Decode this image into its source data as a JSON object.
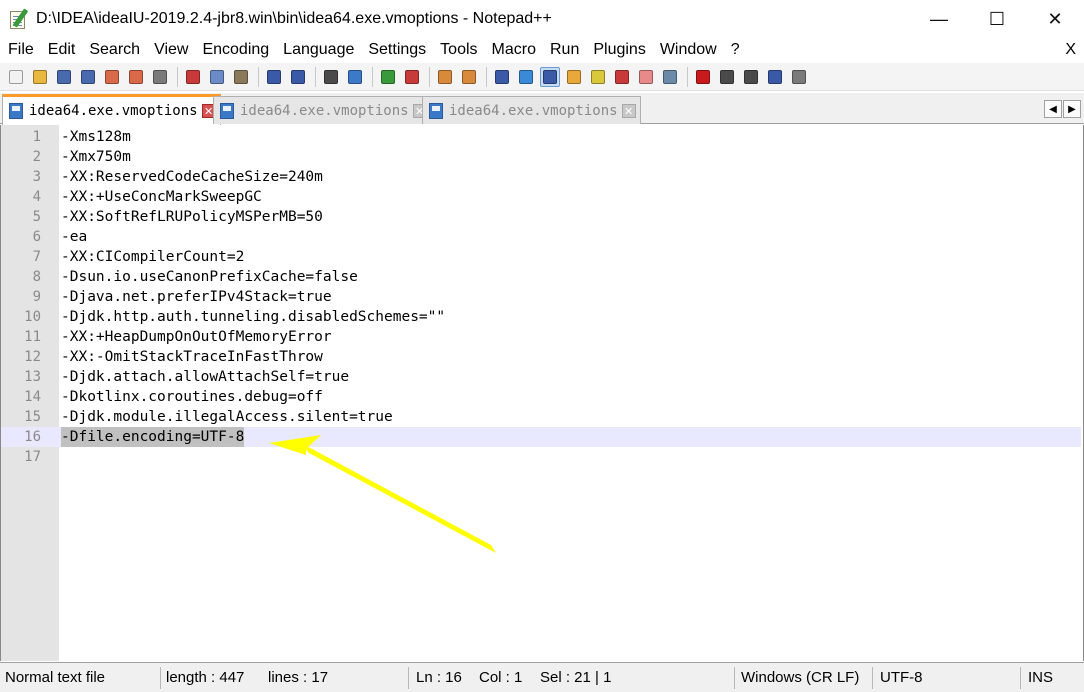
{
  "window": {
    "title": "D:\\IDEA\\ideaIU-2019.2.4-jbr8.win\\bin\\idea64.exe.vmoptions - Notepad++",
    "minimize": "—",
    "maximize": "☐",
    "close": "✕"
  },
  "menu": {
    "items": [
      "File",
      "Edit",
      "Search",
      "View",
      "Encoding",
      "Language",
      "Settings",
      "Tools",
      "Macro",
      "Run",
      "Plugins",
      "Window",
      "?"
    ],
    "close_doc": "X"
  },
  "toolbar": {
    "icons": [
      {
        "name": "new-file-icon",
        "color": "#f2f2f2"
      },
      {
        "name": "open-file-icon",
        "color": "#e8b840"
      },
      {
        "name": "save-icon",
        "color": "#4a6ab0"
      },
      {
        "name": "save-all-icon",
        "color": "#4a6ab0"
      },
      {
        "name": "close-icon",
        "color": "#d86a4a"
      },
      {
        "name": "close-all-icon",
        "color": "#d86a4a"
      },
      {
        "name": "print-icon",
        "color": "#7a7a7a"
      },
      {
        "name": "sep"
      },
      {
        "name": "cut-icon",
        "color": "#c83a3a"
      },
      {
        "name": "copy-icon",
        "color": "#6a8ac8"
      },
      {
        "name": "paste-icon",
        "color": "#8a7a5a"
      },
      {
        "name": "sep"
      },
      {
        "name": "undo-icon",
        "color": "#3a5aa8"
      },
      {
        "name": "redo-icon",
        "color": "#3a5aa8"
      },
      {
        "name": "sep"
      },
      {
        "name": "find-icon",
        "color": "#4a4a4a"
      },
      {
        "name": "replace-icon",
        "color": "#3a7ac8"
      },
      {
        "name": "sep"
      },
      {
        "name": "zoom-in-icon",
        "color": "#3a9a3a"
      },
      {
        "name": "zoom-out-icon",
        "color": "#c83a3a"
      },
      {
        "name": "sep"
      },
      {
        "name": "sync-vertical-icon",
        "color": "#d88a3a"
      },
      {
        "name": "sync-horizontal-icon",
        "color": "#d88a3a"
      },
      {
        "name": "sep"
      },
      {
        "name": "word-wrap-icon",
        "color": "#3a5aa8"
      },
      {
        "name": "show-all-chars-icon",
        "color": "#3a8ad8"
      },
      {
        "name": "indent-guide-icon",
        "color": "#3a5aa8",
        "active": true
      },
      {
        "name": "user-define-language-icon",
        "color": "#e8a83a"
      },
      {
        "name": "document-map-icon",
        "color": "#d8c83a"
      },
      {
        "name": "function-list-icon",
        "color": "#c83a3a"
      },
      {
        "name": "folder-as-workspace-icon",
        "color": "#e88a8a"
      },
      {
        "name": "monitoring-icon",
        "color": "#6a8aa8"
      },
      {
        "name": "sep"
      },
      {
        "name": "record-macro-icon",
        "color": "#c81a1a"
      },
      {
        "name": "stop-recording-icon",
        "color": "#4a4a4a"
      },
      {
        "name": "play-macro-icon",
        "color": "#4a4a4a"
      },
      {
        "name": "run-macro-multiple-icon",
        "color": "#3a5aa8"
      },
      {
        "name": "save-macro-icon",
        "color": "#7a7a7a"
      }
    ]
  },
  "tabs": [
    {
      "label": "idea64.exe.vmoptions",
      "active": true
    },
    {
      "label": "idea64.exe.vmoptions",
      "active": false
    },
    {
      "label": "idea64.exe.vmoptions",
      "active": false
    }
  ],
  "tab_scroll": {
    "left": "◀",
    "right": "▶"
  },
  "editor": {
    "lines": [
      {
        "num": "1",
        "text": "-Xms128m"
      },
      {
        "num": "2",
        "text": "-Xmx750m"
      },
      {
        "num": "3",
        "text": "-XX:ReservedCodeCacheSize=240m"
      },
      {
        "num": "4",
        "text": "-XX:+UseConcMarkSweepGC"
      },
      {
        "num": "5",
        "text": "-XX:SoftRefLRUPolicyMSPerMB=50"
      },
      {
        "num": "6",
        "text": "-ea"
      },
      {
        "num": "7",
        "text": "-XX:CICompilerCount=2"
      },
      {
        "num": "8",
        "text": "-Dsun.io.useCanonPrefixCache=false"
      },
      {
        "num": "9",
        "text": "-Djava.net.preferIPv4Stack=true"
      },
      {
        "num": "10",
        "text": "-Djdk.http.auth.tunneling.disabledSchemes=\"\""
      },
      {
        "num": "11",
        "text": "-XX:+HeapDumpOnOutOfMemoryError"
      },
      {
        "num": "12",
        "text": "-XX:-OmitStackTraceInFastThrow"
      },
      {
        "num": "13",
        "text": "-Djdk.attach.allowAttachSelf=true"
      },
      {
        "num": "14",
        "text": "-Dkotlinx.coroutines.debug=off"
      },
      {
        "num": "15",
        "text": "-Djdk.module.illegalAccess.silent=true"
      },
      {
        "num": "16",
        "text": "-Dfile.encoding=UTF-8",
        "current": true
      },
      {
        "num": "17",
        "text": ""
      }
    ],
    "annotation_color": "#ffff00"
  },
  "status": {
    "file_type": "Normal text file",
    "length": "length : 447",
    "lines": "lines : 17",
    "ln": "Ln : 16",
    "col": "Col : 1",
    "sel": "Sel : 21 | 1",
    "eol": "Windows (CR LF)",
    "encoding": "UTF-8",
    "mode": "INS"
  }
}
